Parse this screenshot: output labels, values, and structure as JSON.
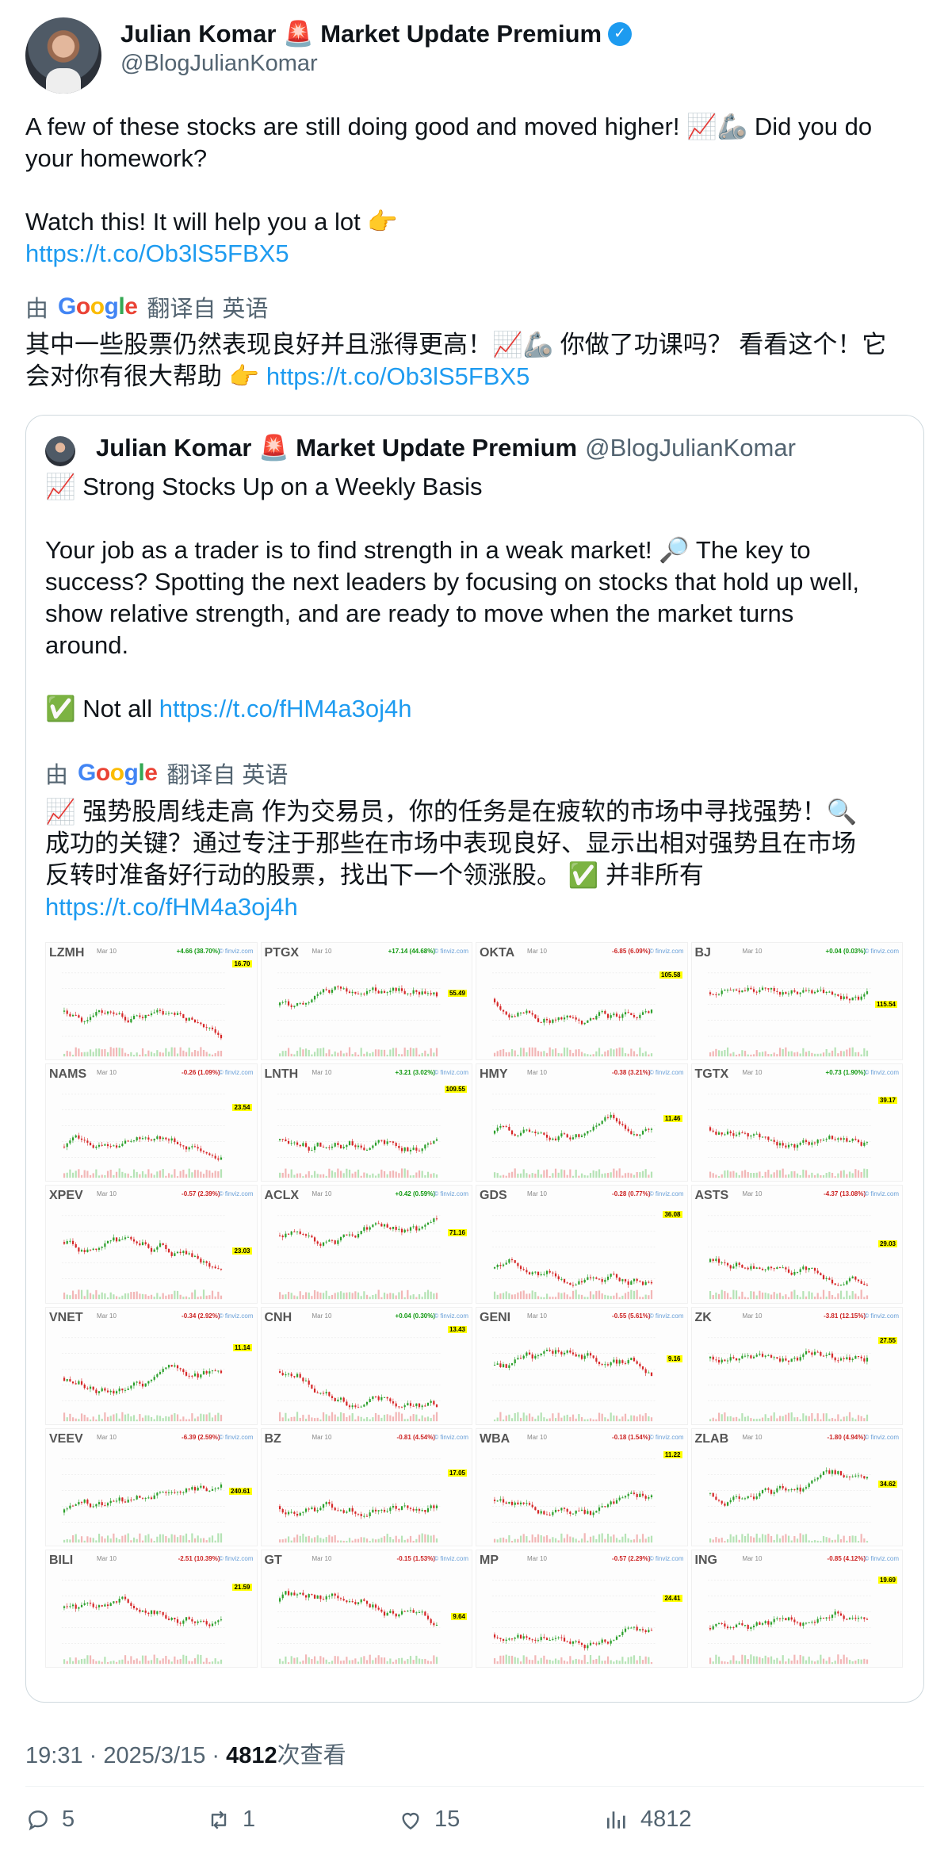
{
  "author": {
    "display_name": "Julian Komar 🚨 Market Update Premium",
    "handle": "@BlogJulianKomar",
    "verified_glyph": "✓"
  },
  "tweet": {
    "text_line1": "A few of these stocks are still doing good and moved higher! 📈🦾 Did you do",
    "text_line2": "your homework?",
    "text_line3": "Watch this! It will help you a lot 👉",
    "link": "https://t.co/Ob3lS5FBX5",
    "translate_prefix": "由",
    "translate_google": "Google",
    "translate_suffix": "翻译自 英语",
    "translated_line1": "其中一些股票仍然表现良好并且涨得更高！📈🦾 你做了功课吗？ 看看这个！它",
    "translated_line2": "会对你有很大帮助 👉",
    "translated_link": "https://t.co/Ob3lS5FBX5"
  },
  "quote": {
    "display_name": "Julian Komar 🚨 Market Update Premium",
    "handle": "@BlogJulianKomar",
    "line_title": "📈 Strong Stocks Up on a Weekly Basis",
    "para1_l1": "Your job as a trader is to find strength in a weak market! 🔎 The key to",
    "para1_l2": "success? Spotting the next leaders by focusing on stocks that hold up well,",
    "para1_l3": "show relative strength, and are ready to move when the market turns",
    "para1_l4": "around.",
    "not_all": "✅ Not all",
    "link": "https://t.co/fHM4a3oj4h",
    "translate_prefix": "由",
    "translate_google": "Google",
    "translate_suffix": "翻译自 英语",
    "tr_l1": "📈 强势股周线走高 作为交易员，你的任务是在疲软的市场中寻找强势！🔍",
    "tr_l2": "成功的关键？通过专注于那些在市场中表现良好、显示出相对强势且在市场",
    "tr_l3": "反转时准备好行动的股票，找出下一个领涨股。 ✅ 并非所有",
    "tr_link": "https://t.co/fHM4a3oj4h"
  },
  "charts": [
    {
      "ticker": "LZMH",
      "date": "Mar 10",
      "change": "+4.66 (38.70%)",
      "dir": "up",
      "price": "16.70",
      "src": "© finviz.com"
    },
    {
      "ticker": "PTGX",
      "date": "Mar 10",
      "change": "+17.14 (44.68%)",
      "dir": "up",
      "price": "55.49",
      "src": "© finviz.com"
    },
    {
      "ticker": "OKTA",
      "date": "Mar 10",
      "change": "-6.85 (6.09%)",
      "dir": "down",
      "price": "105.58",
      "src": "© finviz.com"
    },
    {
      "ticker": "BJ",
      "date": "Mar 10",
      "change": "+0.04 (0.03%)",
      "dir": "up",
      "price": "115.54",
      "src": "© finviz.com"
    },
    {
      "ticker": "NAMS",
      "date": "Mar 10",
      "change": "-0.26 (1.09%)",
      "dir": "down",
      "price": "23.54",
      "src": "© finviz.com"
    },
    {
      "ticker": "LNTH",
      "date": "Mar 10",
      "change": "+3.21 (3.02%)",
      "dir": "up",
      "price": "109.55",
      "src": "© finviz.com"
    },
    {
      "ticker": "HMY",
      "date": "Mar 10",
      "change": "-0.38 (3.21%)",
      "dir": "down",
      "price": "11.46",
      "src": "© finviz.com"
    },
    {
      "ticker": "TGTX",
      "date": "Mar 10",
      "change": "+0.73 (1.90%)",
      "dir": "up",
      "price": "39.17",
      "src": "© finviz.com"
    },
    {
      "ticker": "XPEV",
      "date": "Mar 10",
      "change": "-0.57 (2.39%)",
      "dir": "down",
      "price": "23.03",
      "src": "© finviz.com"
    },
    {
      "ticker": "ACLX",
      "date": "Mar 10",
      "change": "+0.42 (0.59%)",
      "dir": "up",
      "price": "71.16",
      "src": "© finviz.com"
    },
    {
      "ticker": "GDS",
      "date": "Mar 10",
      "change": "-0.28 (0.77%)",
      "dir": "down",
      "price": "36.08",
      "src": "© finviz.com"
    },
    {
      "ticker": "ASTS",
      "date": "Mar 10",
      "change": "-4.37 (13.08%)",
      "dir": "down",
      "price": "29.03",
      "src": "© finviz.com"
    },
    {
      "ticker": "VNET",
      "date": "Mar 10",
      "change": "-0.34 (2.92%)",
      "dir": "down",
      "price": "11.14",
      "src": "© finviz.com"
    },
    {
      "ticker": "CNH",
      "date": "Mar 10",
      "change": "+0.04 (0.30%)",
      "dir": "up",
      "price": "13.43",
      "src": "© finviz.com"
    },
    {
      "ticker": "GENI",
      "date": "Mar 10",
      "change": "-0.55 (5.61%)",
      "dir": "down",
      "price": "9.16",
      "src": "© finviz.com"
    },
    {
      "ticker": "ZK",
      "date": "Mar 10",
      "change": "-3.81 (12.15%)",
      "dir": "down",
      "price": "27.55",
      "src": "© finviz.com"
    },
    {
      "ticker": "VEEV",
      "date": "Mar 10",
      "change": "-6.39 (2.59%)",
      "dir": "down",
      "price": "240.61",
      "src": "© finviz.com"
    },
    {
      "ticker": "BZ",
      "date": "Mar 10",
      "change": "-0.81 (4.54%)",
      "dir": "down",
      "price": "17.05",
      "src": "© finviz.com"
    },
    {
      "ticker": "WBA",
      "date": "Mar 10",
      "change": "-0.18 (1.54%)",
      "dir": "down",
      "price": "11.22",
      "src": "© finviz.com"
    },
    {
      "ticker": "ZLAB",
      "date": "Mar 10",
      "change": "-1.80 (4.94%)",
      "dir": "down",
      "price": "34.62",
      "src": "© finviz.com"
    },
    {
      "ticker": "BILI",
      "date": "Mar 10",
      "change": "-2.51 (10.39%)",
      "dir": "down",
      "price": "21.59",
      "src": "© finviz.com"
    },
    {
      "ticker": "GT",
      "date": "Mar 10",
      "change": "-0.15 (1.53%)",
      "dir": "down",
      "price": "9.64",
      "src": "© finviz.com"
    },
    {
      "ticker": "MP",
      "date": "Mar 10",
      "change": "-0.57 (2.29%)",
      "dir": "down",
      "price": "24.41",
      "src": "© finviz.com"
    },
    {
      "ticker": "ING",
      "date": "Mar 10",
      "change": "-0.85 (4.12%)",
      "dir": "down",
      "price": "19.69",
      "src": "© finviz.com"
    }
  ],
  "meta": {
    "time": "19:31 · 2025/3/15 · ",
    "views_count": "4812",
    "views_label": "次查看"
  },
  "actions": {
    "replies": "5",
    "retweets": "1",
    "likes": "15",
    "views": "4812"
  }
}
